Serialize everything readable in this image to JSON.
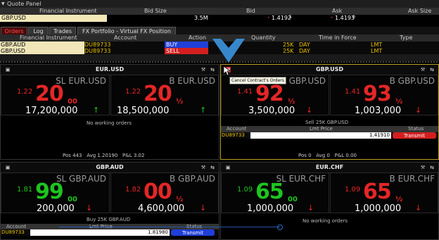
{
  "quote_panel": {
    "title": "Quote Panel",
    "columns": [
      "Financial Instrument",
      "Bid Size",
      "Bid",
      "Ask",
      "Ask Size"
    ],
    "row": {
      "symbol": "GBP.USD",
      "bid_size": "3.5M",
      "bid": "1.4192",
      "bid_sup": "5",
      "ask": "1.4193",
      "ask_sup": "0"
    }
  },
  "tabs": [
    "Orders",
    "Log",
    "Trades",
    "FX Portfolio - Virtual FX Position"
  ],
  "orders": {
    "columns": [
      "Financial Instrument",
      "Account",
      "Action",
      "Quantity",
      "Time in Force",
      "Type"
    ],
    "rows": [
      {
        "symbol": "GBP.AUD",
        "account": "DU89733",
        "action": "BUY",
        "action_color": "#1f3fd9",
        "quantity": "25K",
        "tif": "DAY",
        "type": "LMT"
      },
      {
        "symbol": "GBP.USD",
        "account": "DU89733",
        "action": "SELL",
        "action_color": "#d41f1f",
        "quantity": "25K",
        "tif": "DAY",
        "type": "LMT"
      }
    ]
  },
  "tooltip": "Cancel Contract's Orders",
  "panels": [
    {
      "pair": "EUR.USD",
      "sell": {
        "label": "SL EUR.USD",
        "pre": "1.22",
        "big": "20",
        "sup": "00",
        "qty": "17,200,000",
        "dir": "↑"
      },
      "buy": {
        "label": "B EUR.USD",
        "pre": "1.22",
        "big": "20",
        "sup": "½",
        "qty": "18,500,000",
        "dir": "↑"
      },
      "status": "No working orders",
      "footer": {
        "pos": "Pos  443",
        "avg": "Avg  1.20190",
        "pl": "P&L  3.02"
      }
    },
    {
      "pair": "GBP.USD",
      "sell": {
        "label": "SL GBP.USD",
        "pre": "1.41",
        "big": "92",
        "sup": "½",
        "qty": "3,500,000",
        "dir": "↓"
      },
      "buy": {
        "label": "B GBP.USD",
        "pre": "1.41",
        "big": "93",
        "sup": "½",
        "qty": "1,003,000",
        "dir": "↓"
      },
      "order_title": "Sell 25K GBP.USD",
      "order_cols": [
        "Account",
        "Lmt Price",
        "Status"
      ],
      "order_row": {
        "account": "DU89733",
        "price": "1.41910",
        "status": "Transmit"
      },
      "footer": {
        "pos": "Pos  0",
        "avg": "Avg  0",
        "pl": "P&L  0.00"
      }
    },
    {
      "pair": "GBP.AUD",
      "sell": {
        "label": "SL GBP.AUD",
        "pre": "1.81",
        "big": "99",
        "sup": "00",
        "qty": "200,000",
        "dir": "↓"
      },
      "buy": {
        "label": "B GBP.AUD",
        "pre": "1.82",
        "big": "00",
        "sup": "½",
        "qty": "4,600,000",
        "dir": "↓"
      },
      "order_title": "Buy 25K GBP.AUD",
      "order_cols": [
        "Account",
        "Lmt Price",
        "Status"
      ],
      "order_row": {
        "account": "DU89733",
        "price": "1.81980",
        "status": "Transmit"
      }
    },
    {
      "pair": "EUR.CHF",
      "sell": {
        "label": "SL EUR.CHF",
        "pre": "1.09",
        "big": "65",
        "sup": "00",
        "qty": "1,000,000",
        "dir": "↓"
      },
      "buy": {
        "label": "B EUR.CHF",
        "pre": "1.09",
        "big": "65",
        "sup": "½",
        "qty": "1,000,000",
        "dir": "↓"
      },
      "status": "No working orders"
    }
  ]
}
